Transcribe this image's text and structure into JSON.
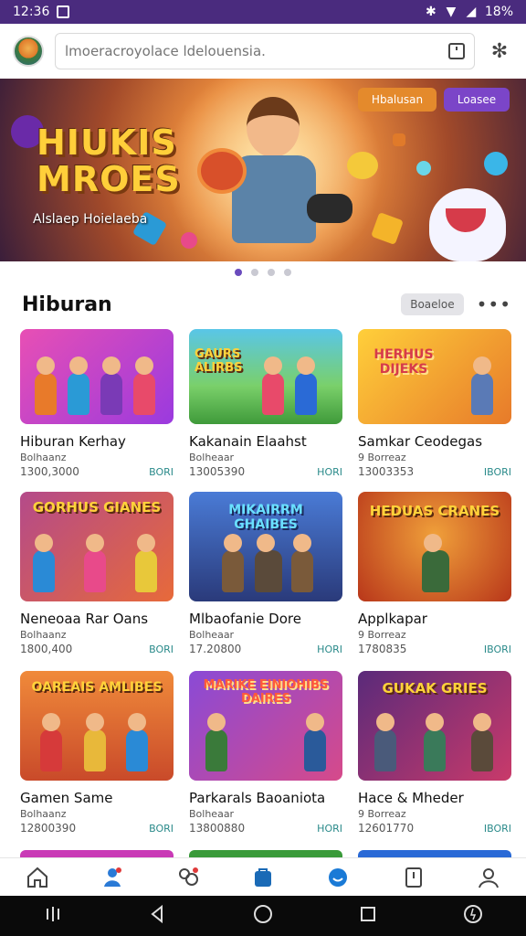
{
  "status": {
    "time": "12:36",
    "battery": "18%"
  },
  "search": {
    "placeholder": "lmoeracroyolace ldelouensia."
  },
  "banner": {
    "title_line1": "HIUKIS",
    "title_line2": "MROES",
    "subtitle": "Alslaep Hoielaeba",
    "button1": "Hbalusan",
    "button2": "Loasee"
  },
  "section": {
    "title": "Hiburan",
    "chip": "Boaeloe",
    "more": "•••"
  },
  "cards": [
    {
      "banner": "",
      "title": "Hiburan Kerhay",
      "meta": "Bolhaanz",
      "num": "1300,3000",
      "tag": "BORI",
      "colors": [
        "#e84fb4",
        "#9a3adf"
      ]
    },
    {
      "banner": "GAURS ALIRBS",
      "title": "Kakanain Elaahst",
      "meta": "Bolheaar",
      "num": "13005390",
      "tag": "HORI",
      "colors": [
        "#59c6e8",
        "#3f9a3a"
      ]
    },
    {
      "banner": "HERHUS DIJEKS",
      "title": "Samkar Ceodegas",
      "meta": "9 Borreaz",
      "num": "13003353",
      "tag": "IBORI",
      "colors": [
        "#ffcf3a",
        "#e77a2a"
      ]
    },
    {
      "banner": "GORHUS GIANES",
      "title": "Neneoaa Rar Oans",
      "meta": "Bolhaanz",
      "num": "1800,400",
      "tag": "BORI",
      "colors": [
        "#b44a8a",
        "#e76a3a"
      ]
    },
    {
      "banner": "MIKAIRRM GHAIBES",
      "title": "Mlbaofanie Dore",
      "meta": "Bolheaar",
      "num": "17.20800",
      "tag": "HORI",
      "colors": [
        "#4a7bd6",
        "#2a3a7a"
      ]
    },
    {
      "banner": "HEDUAS CRANES",
      "title": "Applkapar",
      "meta": "9 Borreaz",
      "num": "1780835",
      "tag": "IBORI",
      "colors": [
        "#f0a03a",
        "#b8361a"
      ]
    },
    {
      "banner": "OAREAIS AMLIBES",
      "title": "Gamen Same",
      "meta": "Bolhaanz",
      "num": "12800390",
      "tag": "BORI",
      "colors": [
        "#f08a3a",
        "#c94a2a"
      ]
    },
    {
      "banner": "MARIKE EINIOHIBS DAIRES",
      "title": "Parkarals Baoaniota",
      "meta": "Bolheaar",
      "num": "13800880",
      "tag": "HORI",
      "colors": [
        "#8a4ad6",
        "#d64a8a"
      ]
    },
    {
      "banner": "GUKAK GRIES",
      "title": "Hace & Mheder",
      "meta": "9 Borreaz",
      "num": "12601770",
      "tag": "IBORI",
      "colors": [
        "#5a2a7a",
        "#c93a6a"
      ]
    }
  ],
  "nav_icons": [
    "home-icon",
    "people-icon",
    "group-icon",
    "shop-icon",
    "smile-icon",
    "bookmark-icon",
    "profile-icon"
  ]
}
